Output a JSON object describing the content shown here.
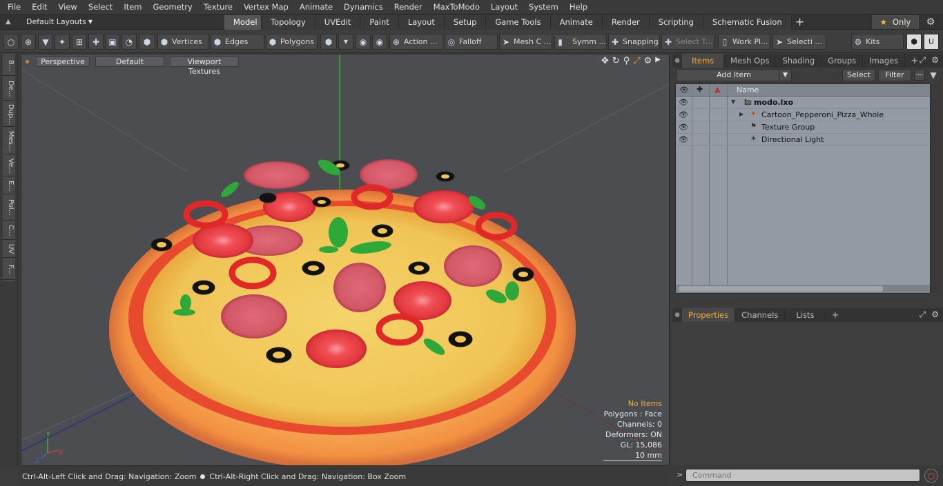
{
  "menu": [
    "File",
    "Edit",
    "View",
    "Select",
    "Item",
    "Geometry",
    "Texture",
    "Vertex Map",
    "Animate",
    "Dynamics",
    "Render",
    "MaxToModo",
    "Layout",
    "System",
    "Help"
  ],
  "layout": {
    "dropdown_label": "Default Layouts",
    "tabs": [
      "Model",
      "Topology",
      "UVEdit",
      "Paint",
      "Layout",
      "Setup",
      "Game Tools",
      "Animate",
      "Render",
      "Scripting",
      "Schematic Fusion"
    ],
    "active_tab": "Model",
    "only_label": "Only"
  },
  "toolbar": {
    "vertices": "Vertices",
    "edges": "Edges",
    "polygons": "Polygons",
    "action": "Action ...",
    "falloff": "Falloff",
    "mesh_c": "Mesh C ...",
    "symm": "Symm ...",
    "snapping": "Snapping",
    "select_t": "Select T...",
    "work_pl": "Work Pl...",
    "selecti": "Selecti ...",
    "kits": "Kits"
  },
  "left_tabs": [
    "B...",
    "De...",
    "Dup...",
    "Mes...",
    "Ve...",
    "E...",
    "Pol...",
    "C...",
    "UV",
    "F..."
  ],
  "viewport": {
    "view_mode": "Perspective",
    "shading": "Default",
    "textures": "Viewport Textures",
    "info": {
      "selection": "No Items",
      "polygons": "Polygons : Face",
      "channels": "Channels: 0",
      "deformers": "Deformers: ON",
      "gl": "GL: 15,086",
      "scale": "10 mm"
    }
  },
  "status": {
    "left": "Ctrl-Alt-Left Click and Drag: Navigation: Zoom",
    "right": "Ctrl-Alt-Right Click and Drag: Navigation: Box Zoom"
  },
  "items_panel": {
    "tabs": [
      "Items",
      "Mesh Ops",
      "Shading",
      "Groups",
      "Images"
    ],
    "active_tab": "Items",
    "add_item": "Add Item",
    "select": "Select",
    "filter": "Filter",
    "column_name": "Name",
    "items": [
      {
        "label": "modo.lxo",
        "bold": true
      },
      {
        "label": "Cartoon_Pepperoni_Pizza_Whole",
        "bold": false
      },
      {
        "label": "Texture Group",
        "bold": false
      },
      {
        "label": "Directional Light",
        "bold": false
      }
    ]
  },
  "props_panel": {
    "tabs": [
      "Properties",
      "Channels",
      "Lists"
    ],
    "active_tab": "Properties"
  },
  "command": {
    "placeholder": "Command"
  },
  "colors": {
    "accent": "#f0b030",
    "viewport_bg": "#4b4d50",
    "list_bg": "#939aa3"
  }
}
